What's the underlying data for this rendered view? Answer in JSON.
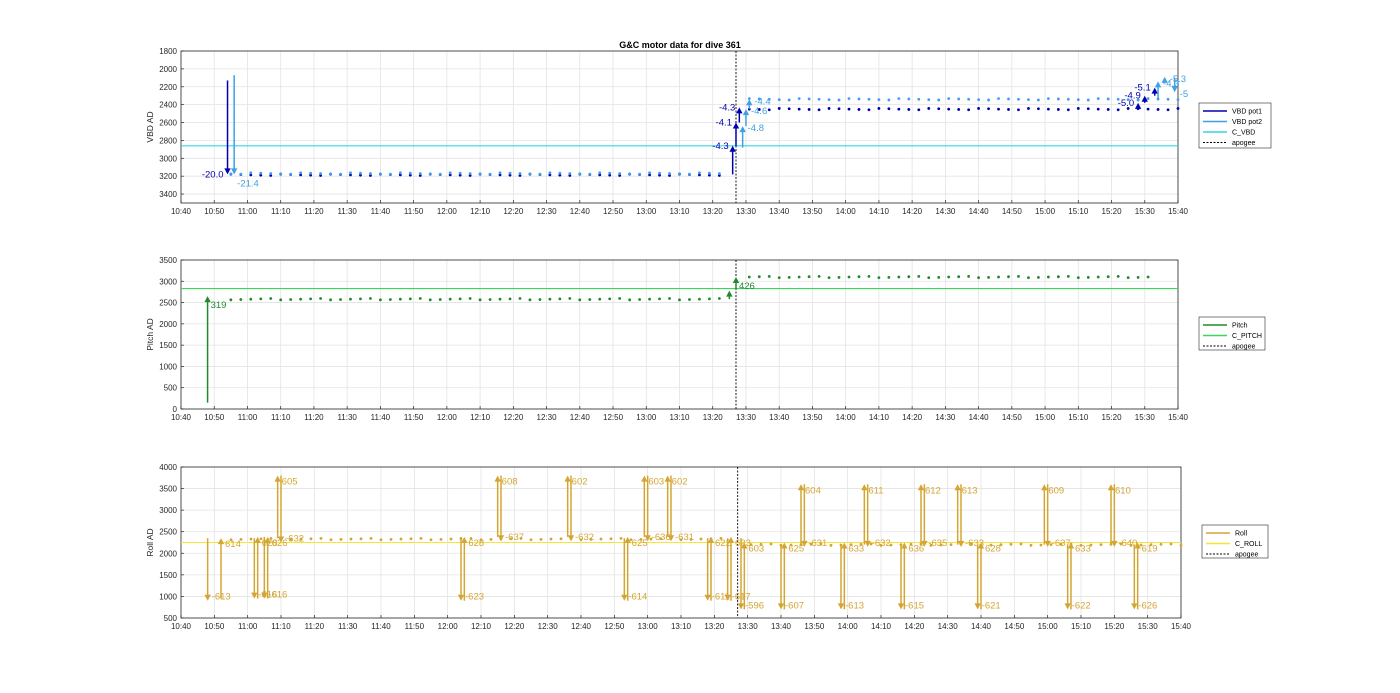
{
  "title": "G&C motor data for dive 361",
  "x_tick_labels": [
    "10:40",
    "10:50",
    "11:00",
    "11:10",
    "11:20",
    "11:30",
    "11:40",
    "11:50",
    "12:00",
    "12:10",
    "12:20",
    "12:30",
    "12:40",
    "12:50",
    "13:00",
    "13:10",
    "13:20",
    "13:30",
    "13:40",
    "13:50",
    "14:00",
    "14:10",
    "14:20",
    "14:30",
    "14:40",
    "14:50",
    "15:00",
    "15:10",
    "15:20",
    "15:30",
    "15:40"
  ],
  "colors": {
    "vbd_pot1": "#0000b3",
    "vbd_pot2": "#3fa0e6",
    "c_vbd": "#33d6e6",
    "pitch": "#1e8a2c",
    "c_pitch": "#3dd65a",
    "roll": "#d4a533",
    "c_roll": "#f2e63c",
    "apogee": "#000000"
  },
  "chart_data": [
    {
      "type": "scatter",
      "ylabel": "VBD AD",
      "ylim": [
        3500,
        1800
      ],
      "y_ticks": [
        1800,
        2000,
        2200,
        2400,
        2600,
        2800,
        3000,
        3200,
        3400
      ],
      "grid": true,
      "legend_position": "right",
      "legend": [
        "VBD pot1",
        "VBD pot2",
        "C_VBD",
        "apogee"
      ],
      "apogee_minutes": 167,
      "reference_line": {
        "name": "C_VBD",
        "value": 2860
      },
      "series": [
        {
          "name": "VBD pot1",
          "before_apogee": 3185,
          "after_apogee": 2450
        },
        {
          "name": "VBD pot2",
          "before_apogee": 3170,
          "after_apogee": 2340
        }
      ],
      "moves": [
        {
          "series": "VBD pot1",
          "t": 14,
          "from": 2130,
          "to": 3180,
          "label": "-20.0",
          "label_side": "left"
        },
        {
          "series": "VBD pot2",
          "t": 16,
          "from": 2070,
          "to": 3180,
          "label": "-21.4",
          "label_side": "below"
        },
        {
          "series": "VBD pot1",
          "t": 166,
          "from": 3180,
          "to": 2860,
          "label": "-4.3",
          "label_side": "left"
        },
        {
          "series": "VBD pot1",
          "t": 167,
          "from": 2860,
          "to": 2600,
          "label": "-4.1",
          "label_side": "left"
        },
        {
          "series": "VBD pot1",
          "t": 168,
          "from": 2600,
          "to": 2430,
          "label": "-4.3",
          "label_side": "left"
        },
        {
          "series": "VBD pot2",
          "t": 169,
          "from": 2880,
          "to": 2640,
          "label": "-4.8",
          "label_side": "right"
        },
        {
          "series": "VBD pot2",
          "t": 170,
          "from": 2640,
          "to": 2450,
          "label": "-4.6",
          "label_side": "right"
        },
        {
          "series": "VBD pot2",
          "t": 171,
          "from": 2450,
          "to": 2340,
          "label": "-4.4",
          "label_side": "right"
        },
        {
          "series": "VBD pot1",
          "t": 288,
          "from": 2450,
          "to": 2380,
          "label": "-5.0",
          "label_side": "left"
        },
        {
          "series": "VBD pot1",
          "t": 290,
          "from": 2380,
          "to": 2300,
          "label": "-4.9",
          "label_side": "left"
        },
        {
          "series": "VBD pot1",
          "t": 293,
          "from": 2300,
          "to": 2210,
          "label": "-5.1",
          "label_side": "left"
        },
        {
          "series": "VBD pot2",
          "t": 294,
          "from": 2350,
          "to": 2140,
          "label": "-4.3",
          "label_side": "right"
        },
        {
          "series": "VBD pot2",
          "t": 296,
          "from": 2140,
          "to": 2090,
          "label": "-5.3",
          "label_side": "right"
        },
        {
          "series": "VBD pot2",
          "t": 299,
          "from": 2100,
          "to": 2260,
          "label": "-5",
          "label_side": "right"
        }
      ]
    },
    {
      "type": "scatter",
      "ylabel": "Pitch AD",
      "ylim": [
        0,
        3500
      ],
      "y_ticks": [
        0,
        500,
        1000,
        1500,
        2000,
        2500,
        3000,
        3500
      ],
      "grid": true,
      "legend_position": "right",
      "legend": [
        "Pitch",
        "C_PITCH",
        "apogee"
      ],
      "apogee_minutes": 167,
      "reference_line": {
        "name": "C_PITCH",
        "value": 2830
      },
      "series": [
        {
          "name": "Pitch",
          "before_apogee": 2580,
          "after_apogee": 3100
        }
      ],
      "moves": [
        {
          "series": "Pitch",
          "t": 8,
          "from": 150,
          "to": 2650,
          "label": "319",
          "label_side": "below"
        },
        {
          "series": "Pitch",
          "t": 165,
          "from": 2580,
          "to": 2780,
          "label": "",
          "label_side": "none"
        },
        {
          "series": "Pitch",
          "t": 167,
          "from": 2800,
          "to": 3100,
          "label": "426",
          "label_side": "below"
        }
      ]
    },
    {
      "type": "scatter",
      "ylabel": "Roll AD",
      "ylim": [
        500,
        4000
      ],
      "y_ticks": [
        500,
        1000,
        1500,
        2000,
        2500,
        3000,
        3500,
        4000
      ],
      "grid": true,
      "legend_position": "right",
      "legend": [
        "Roll",
        "C_ROLL",
        "apogee"
      ],
      "apogee_minutes": 167,
      "reference_line": {
        "name": "C_ROLL",
        "value": 2250
      },
      "series": [
        {
          "name": "Roll",
          "before_apogee": 2330,
          "after_apogee": 2200
        }
      ],
      "moves": [
        {
          "t": 8,
          "from": 2350,
          "to": 900,
          "label": "-613"
        },
        {
          "t": 12,
          "from": 950,
          "to": 2350,
          "label": "614"
        },
        {
          "t": 22,
          "from": 2350,
          "to": 950,
          "label": "-616"
        },
        {
          "t": 23,
          "from": 950,
          "to": 2380,
          "label": "628"
        },
        {
          "t": 25,
          "from": 2380,
          "to": 950,
          "label": "-616"
        },
        {
          "t": 26,
          "from": 950,
          "to": 2380,
          "label": "626"
        },
        {
          "t": 29,
          "from": 2350,
          "to": 3800,
          "label": "605"
        },
        {
          "t": 30,
          "from": 3800,
          "to": 2250,
          "label": "-632"
        },
        {
          "t": 84,
          "from": 2380,
          "to": 900,
          "label": "-623"
        },
        {
          "t": 85,
          "from": 900,
          "to": 2380,
          "label": "628"
        },
        {
          "t": 95,
          "from": 2380,
          "to": 3800,
          "label": "608"
        },
        {
          "t": 96,
          "from": 3800,
          "to": 2280,
          "label": "-637"
        },
        {
          "t": 116,
          "from": 2380,
          "to": 3800,
          "label": "602"
        },
        {
          "t": 117,
          "from": 3800,
          "to": 2280,
          "label": "-632"
        },
        {
          "t": 133,
          "from": 2350,
          "to": 900,
          "label": "-614"
        },
        {
          "t": 134,
          "from": 900,
          "to": 2380,
          "label": "625"
        },
        {
          "t": 139,
          "from": 2380,
          "to": 3800,
          "label": "603"
        },
        {
          "t": 140,
          "from": 3800,
          "to": 2280,
          "label": "-636"
        },
        {
          "t": 146,
          "from": 2380,
          "to": 3800,
          "label": "602"
        },
        {
          "t": 147,
          "from": 3800,
          "to": 2280,
          "label": "-631"
        },
        {
          "t": 158,
          "from": 2350,
          "to": 900,
          "label": "-611"
        },
        {
          "t": 159,
          "from": 900,
          "to": 2380,
          "label": "622"
        },
        {
          "t": 164,
          "from": 2350,
          "to": 900,
          "label": "-617"
        },
        {
          "t": 165,
          "from": 900,
          "to": 2380,
          "label": "623"
        },
        {
          "t": 168,
          "from": 2350,
          "to": 700,
          "label": "-596"
        },
        {
          "t": 169,
          "from": 700,
          "to": 2250,
          "label": "603"
        },
        {
          "t": 180,
          "from": 2200,
          "to": 700,
          "label": "-607"
        },
        {
          "t": 181,
          "from": 700,
          "to": 2250,
          "label": "625"
        },
        {
          "t": 186,
          "from": 2200,
          "to": 3600,
          "label": "604"
        },
        {
          "t": 187,
          "from": 3600,
          "to": 2150,
          "label": "-631"
        },
        {
          "t": 198,
          "from": 2200,
          "to": 700,
          "label": "-613"
        },
        {
          "t": 199,
          "from": 700,
          "to": 2250,
          "label": "633"
        },
        {
          "t": 205,
          "from": 2200,
          "to": 3600,
          "label": "611"
        },
        {
          "t": 206,
          "from": 3600,
          "to": 2150,
          "label": "-632"
        },
        {
          "t": 216,
          "from": 2200,
          "to": 700,
          "label": "-615"
        },
        {
          "t": 217,
          "from": 700,
          "to": 2250,
          "label": "636"
        },
        {
          "t": 222,
          "from": 2200,
          "to": 3600,
          "label": "612"
        },
        {
          "t": 223,
          "from": 3600,
          "to": 2150,
          "label": "-635"
        },
        {
          "t": 233,
          "from": 2200,
          "to": 3600,
          "label": "613"
        },
        {
          "t": 234,
          "from": 3600,
          "to": 2150,
          "label": "-633"
        },
        {
          "t": 239,
          "from": 2200,
          "to": 700,
          "label": "-621"
        },
        {
          "t": 240,
          "from": 700,
          "to": 2250,
          "label": "628"
        },
        {
          "t": 259,
          "from": 2200,
          "to": 3600,
          "label": "609"
        },
        {
          "t": 260,
          "from": 3600,
          "to": 2150,
          "label": "-637"
        },
        {
          "t": 266,
          "from": 2200,
          "to": 700,
          "label": "-622"
        },
        {
          "t": 267,
          "from": 700,
          "to": 2250,
          "label": "633"
        },
        {
          "t": 279,
          "from": 2200,
          "to": 3600,
          "label": "610"
        },
        {
          "t": 280,
          "from": 3600,
          "to": 2150,
          "label": "-640"
        },
        {
          "t": 286,
          "from": 2200,
          "to": 700,
          "label": "-626"
        },
        {
          "t": 287,
          "from": 700,
          "to": 2250,
          "label": "619"
        }
      ]
    }
  ]
}
